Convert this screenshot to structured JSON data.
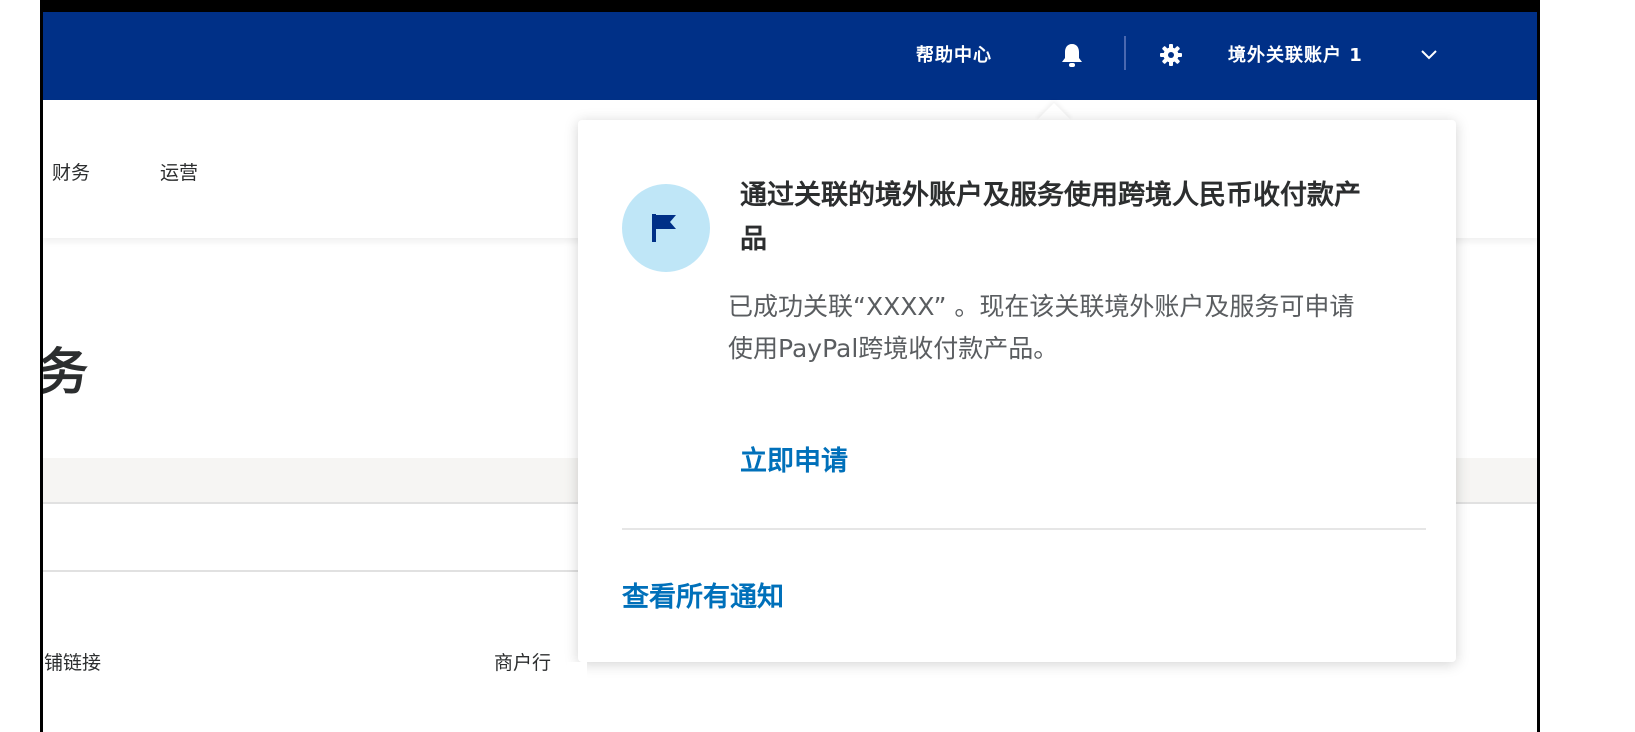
{
  "header": {
    "help_label": "帮助中心",
    "account_label": "境外关联账户 1",
    "bg_color": "#003087"
  },
  "subnav": {
    "items": [
      {
        "label": "财务"
      },
      {
        "label": "运营"
      }
    ]
  },
  "page": {
    "heading_fragment": "务"
  },
  "table": {
    "columns": [
      {
        "label": "铺链接"
      },
      {
        "label": "商户行"
      }
    ]
  },
  "notification": {
    "title": "通过关联的境外账户及服务使用跨境人民币收付款产品",
    "body": "已成功关联“XXXX” 。现在该关联境外账户及服务可申请使用PayPal跨境收付款产品。",
    "action_label": "立即申请",
    "view_all_label": "查看所有通知",
    "icon": "flag-icon",
    "accent_color": "#0070ba",
    "icon_bg_color": "#bfe6f7"
  }
}
